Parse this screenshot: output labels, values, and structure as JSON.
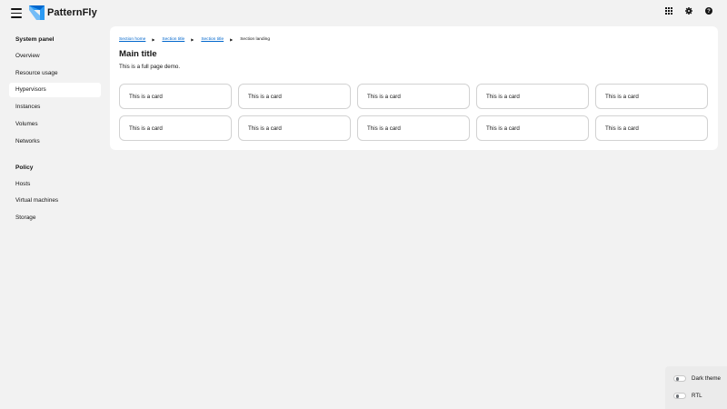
{
  "masthead": {
    "brand": "PatternFly",
    "icons": [
      "hamburger-icon",
      "apps-grid-icon",
      "gear-icon",
      "help-icon"
    ]
  },
  "sidebar": {
    "groups": [
      {
        "title": "System panel",
        "items": [
          {
            "label": "Overview"
          },
          {
            "label": "Resource usage"
          },
          {
            "label": "Hypervisors",
            "active": true
          },
          {
            "label": "Instances"
          },
          {
            "label": "Volumes"
          },
          {
            "label": "Networks"
          }
        ]
      },
      {
        "title": "Policy",
        "items": [
          {
            "label": "Hosts"
          },
          {
            "label": "Virtual machines"
          },
          {
            "label": "Storage"
          }
        ]
      }
    ]
  },
  "breadcrumb": {
    "items": [
      "Section home",
      "Section title",
      "Section title"
    ],
    "current": "Section landing"
  },
  "main": {
    "title": "Main title",
    "description": "This is a full page demo.",
    "cards": [
      "This is a card",
      "This is a card",
      "This is a card",
      "This is a card",
      "This is a card",
      "This is a card",
      "This is a card",
      "This is a card",
      "This is a card",
      "This is a card"
    ]
  },
  "theme_panel": {
    "dark_theme_label": "Dark theme",
    "rtl_label": "RTL"
  },
  "colors": {
    "background": "#f2f2f2",
    "surface": "#ffffff",
    "link": "#0066cc",
    "card_border": "#d2d2d2",
    "brand_blue": "#2b9af3"
  }
}
